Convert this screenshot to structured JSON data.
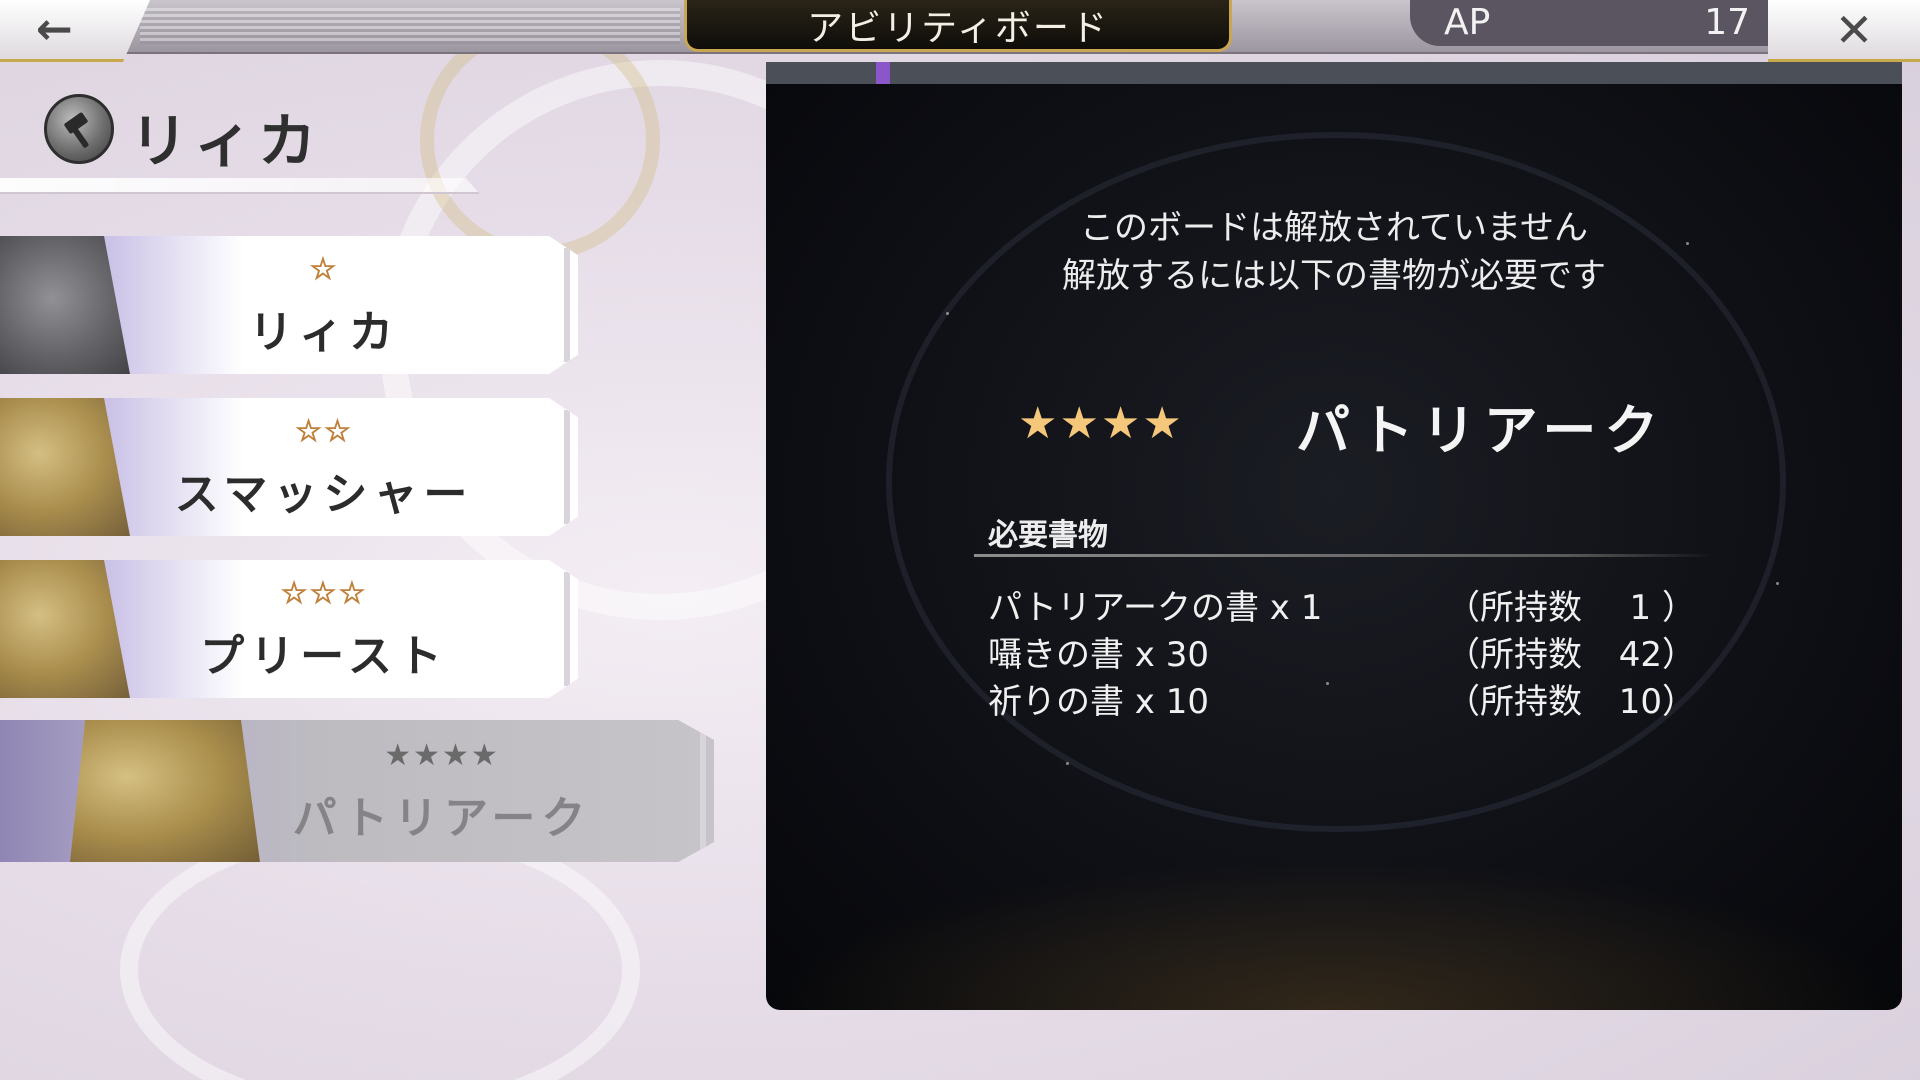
{
  "header": {
    "title": "アビリティボード",
    "back_icon": "back-arrow-icon",
    "close_icon": "close-icon",
    "ap": {
      "label": "AP",
      "value": "17"
    }
  },
  "character": {
    "name": "リィカ",
    "icon": "hammer-emblem-icon"
  },
  "jobs": [
    {
      "stars": "☆",
      "name": "リィカ",
      "locked": false
    },
    {
      "stars": "☆☆",
      "name": "スマッシャー",
      "locked": false
    },
    {
      "stars": "☆☆☆",
      "name": "プリースト",
      "locked": false
    },
    {
      "stars": "★★★★",
      "name": "パトリアーク",
      "locked": true
    }
  ],
  "panel": {
    "notice_line1": "このボードは解放されていません",
    "notice_line2": "解放するには以下の書物が必要です",
    "featured": {
      "stars": "★★★★",
      "name": "パトリアーク"
    },
    "requirements_header": "必要書物",
    "requirements": [
      {
        "item": "パトリアークの書 x 1",
        "own_label": "（所持数",
        "own_count": "1 ）"
      },
      {
        "item": "囁きの書 x 30",
        "own_label": "（所持数",
        "own_count": "42）"
      },
      {
        "item": "祈りの書 x 10",
        "own_label": "（所持数",
        "own_count": "10）"
      }
    ]
  },
  "colors": {
    "accent_gold": "#c9a654",
    "star_orange": "#f2b04a",
    "panel_bg": "#0c0d12",
    "purple_accent": "#8a56c9"
  }
}
